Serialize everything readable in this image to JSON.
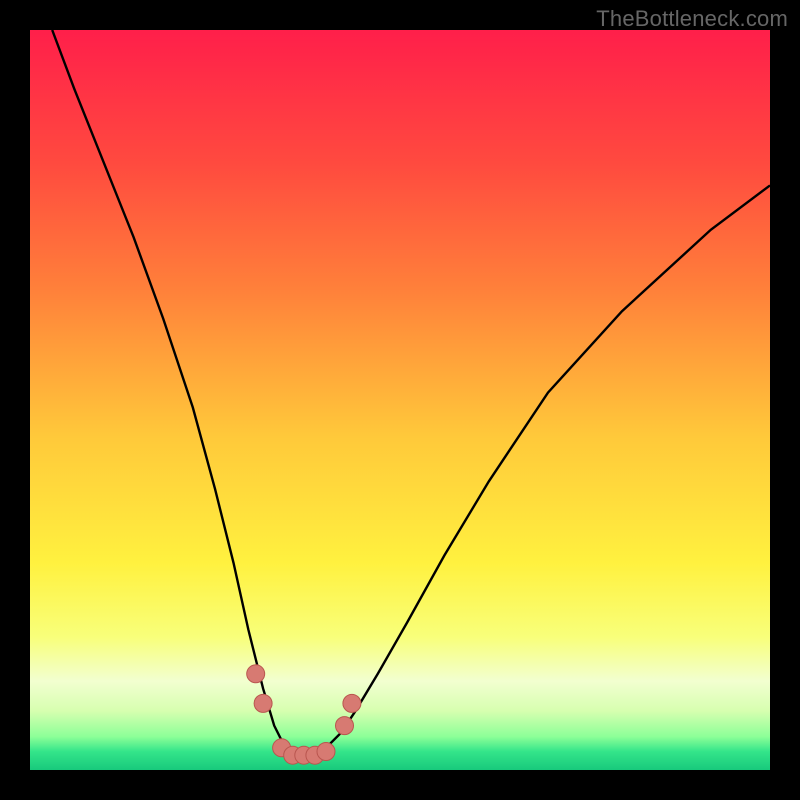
{
  "watermark": {
    "text": "TheBottleneck.com"
  },
  "colors": {
    "frame": "#000000",
    "curve_stroke": "#000000",
    "marker_fill": "#d77a72",
    "marker_stroke": "#b9564f",
    "gradient_stops": [
      {
        "offset": 0.0,
        "color": "#ff1f4a"
      },
      {
        "offset": 0.18,
        "color": "#ff4a3f"
      },
      {
        "offset": 0.35,
        "color": "#ff803a"
      },
      {
        "offset": 0.55,
        "color": "#ffc93a"
      },
      {
        "offset": 0.72,
        "color": "#fff13f"
      },
      {
        "offset": 0.82,
        "color": "#f8ff7a"
      },
      {
        "offset": 0.88,
        "color": "#f2ffd0"
      },
      {
        "offset": 0.92,
        "color": "#d7ffb0"
      },
      {
        "offset": 0.955,
        "color": "#8cff98"
      },
      {
        "offset": 0.975,
        "color": "#34e58a"
      },
      {
        "offset": 1.0,
        "color": "#18c97c"
      }
    ]
  },
  "chart_data": {
    "type": "line",
    "title": "",
    "xlabel": "",
    "ylabel": "",
    "xlim": [
      0,
      100
    ],
    "ylim": [
      0,
      100
    ],
    "grid": false,
    "series": [
      {
        "name": "bottleneck-curve",
        "x": [
          3,
          6,
          10,
          14,
          18,
          22,
          25,
          27.5,
          29.5,
          31.5,
          33,
          34.5,
          36,
          38,
          40,
          42,
          44,
          47,
          51,
          56,
          62,
          70,
          80,
          92,
          100
        ],
        "values": [
          100,
          92,
          82,
          72,
          61,
          49,
          38,
          28,
          19,
          11,
          6,
          3,
          2,
          2,
          3,
          5,
          8,
          13,
          20,
          29,
          39,
          51,
          62,
          73,
          79
        ]
      }
    ],
    "markers": [
      {
        "x": 30.5,
        "y": 13
      },
      {
        "x": 31.5,
        "y": 9
      },
      {
        "x": 34.0,
        "y": 3
      },
      {
        "x": 35.5,
        "y": 2
      },
      {
        "x": 37.0,
        "y": 2
      },
      {
        "x": 38.5,
        "y": 2
      },
      {
        "x": 40.0,
        "y": 2.5
      },
      {
        "x": 42.5,
        "y": 6
      },
      {
        "x": 43.5,
        "y": 9
      }
    ]
  }
}
